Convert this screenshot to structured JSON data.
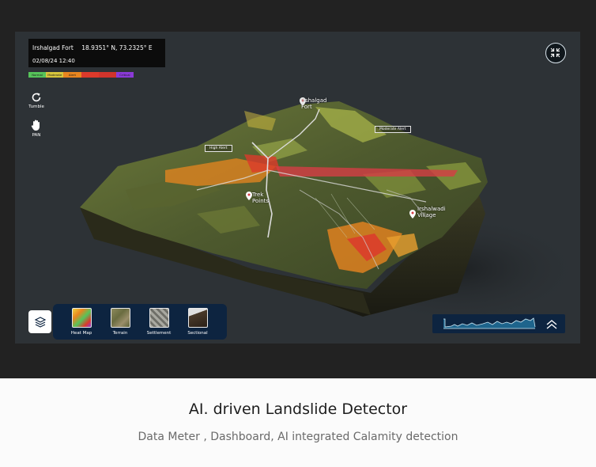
{
  "location": {
    "name": "Irshalgad Fort",
    "coords": "18.9351° N, 73.2325° E",
    "datetime": "02/08/24  12:40"
  },
  "legend": [
    {
      "label": "Normal",
      "color": "#56c45a"
    },
    {
      "label": "Moderate",
      "color": "#d7c53c"
    },
    {
      "label": "Alert",
      "color": "#e8851f"
    },
    {
      "label": "",
      "color": "#dc3a2b"
    },
    {
      "label": "",
      "color": "#d0342c"
    },
    {
      "label": "Critical",
      "color": "#8b3ad8"
    }
  ],
  "tools": {
    "tumble_label": "Tumble",
    "pan_label": "PAN"
  },
  "map_labels": {
    "fort": "Irshalgad\nFort",
    "trek": "Trek\nPoints",
    "village": "Irshalwadi\nVillage",
    "high_alert": "High Alert",
    "moderate_alert": "Moderate Alert"
  },
  "layers": [
    {
      "label": "Heat Map",
      "icon": "heatmap-icon"
    },
    {
      "label": "Terrain",
      "icon": "terrain-icon"
    },
    {
      "label": "Settlement",
      "icon": "settlement-icon"
    },
    {
      "label": "Sectional",
      "icon": "sectional-icon"
    }
  ],
  "caption": {
    "title": "AI. driven Landslide Detector",
    "subtitle": "Data Meter , Dashboard, AI integrated Calamity detection"
  }
}
